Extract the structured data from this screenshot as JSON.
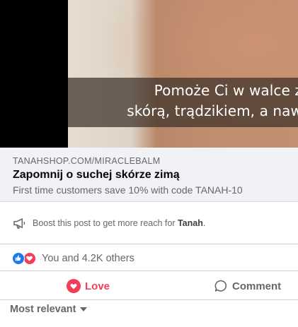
{
  "video": {
    "caption_line1": "Pomoże Ci w walce z",
    "caption_line2": "skórą, trądzikiem, a naw"
  },
  "link_card": {
    "domain": "TANAHSHOP.COM/MIRACLEBALM",
    "title": "Zapomnij o suchej skórze zimą",
    "description": "First time customers save 10% with code TANAH-10"
  },
  "boost": {
    "text_before": "Boost this post to get more reach for ",
    "page_name": "Tanah",
    "text_after": ".",
    "icon": "megaphone-icon"
  },
  "reactions": {
    "icons": [
      "like-icon",
      "love-icon"
    ],
    "summary": "You and 4.2K others"
  },
  "actions": {
    "love_label": "Love",
    "comment_label": "Comment"
  },
  "comments": {
    "sort_label": "Most relevant"
  },
  "colors": {
    "like_blue": "#1877f2",
    "love_red": "#f33e58",
    "secondary_text": "#65676b"
  }
}
